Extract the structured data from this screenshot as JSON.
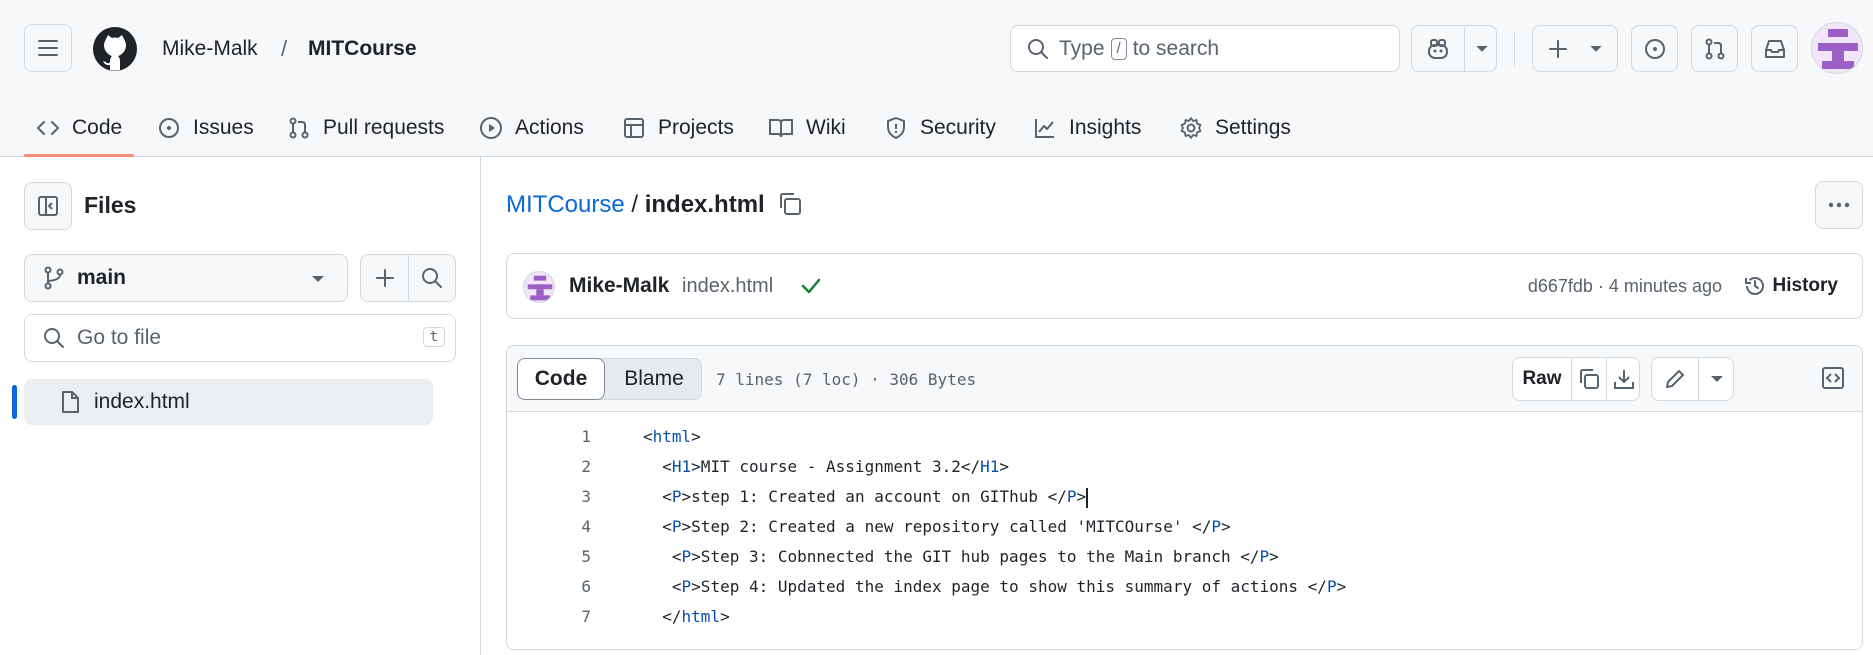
{
  "header": {
    "owner": "Mike-Malk",
    "separator": "/",
    "repo": "MITCourse",
    "search": {
      "prefix": "Type",
      "key": "/",
      "suffix": "to search"
    }
  },
  "tabs": [
    {
      "label": "Code",
      "icon": "code-icon",
      "active": true
    },
    {
      "label": "Issues",
      "icon": "issue-opened-icon"
    },
    {
      "label": "Pull requests",
      "icon": "git-pull-request-icon"
    },
    {
      "label": "Actions",
      "icon": "play-icon"
    },
    {
      "label": "Projects",
      "icon": "table-icon"
    },
    {
      "label": "Wiki",
      "icon": "book-icon"
    },
    {
      "label": "Security",
      "icon": "shield-icon"
    },
    {
      "label": "Insights",
      "icon": "graph-icon"
    },
    {
      "label": "Settings",
      "icon": "gear-icon"
    }
  ],
  "sidebar": {
    "title": "Files",
    "branch": "main",
    "goto_placeholder": "Go to file",
    "goto_shortcut": "t",
    "files": [
      {
        "name": "index.html",
        "selected": true
      }
    ]
  },
  "breadcrumb": {
    "repo": "MITCourse",
    "separator": "/",
    "file": "index.html"
  },
  "commit": {
    "author": "Mike-Malk",
    "message": "index.html",
    "meta": "d667fdb · 4 minutes ago",
    "history_label": "History"
  },
  "file_view": {
    "tab_code": "Code",
    "tab_blame": "Blame",
    "info": "7 lines (7 loc) · 306 Bytes",
    "raw_label": "Raw"
  },
  "code_lines": [
    {
      "n": "1",
      "text": "<html>"
    },
    {
      "n": "2",
      "text": "  <H1>MIT course - Assignment 3.2</H1>"
    },
    {
      "n": "3",
      "text": "  <P>step 1: Created an account on GIThub </P>"
    },
    {
      "n": "4",
      "text": "  <P>Step 2: Created a new repository called 'MITCOurse' </P>"
    },
    {
      "n": "5",
      "text": "   <P>Step 3: Cobnnected the GIT hub pages to the Main branch </P>"
    },
    {
      "n": "6",
      "text": "   <P>Step 4: Updated the index page to show this summary of actions </P>"
    },
    {
      "n": "7",
      "text": "  </html>"
    }
  ],
  "colors": {
    "accent": "#0969da",
    "tab_underline": "#fd8c73",
    "success": "#1a7f37",
    "avatar": "#9b5fc6"
  }
}
